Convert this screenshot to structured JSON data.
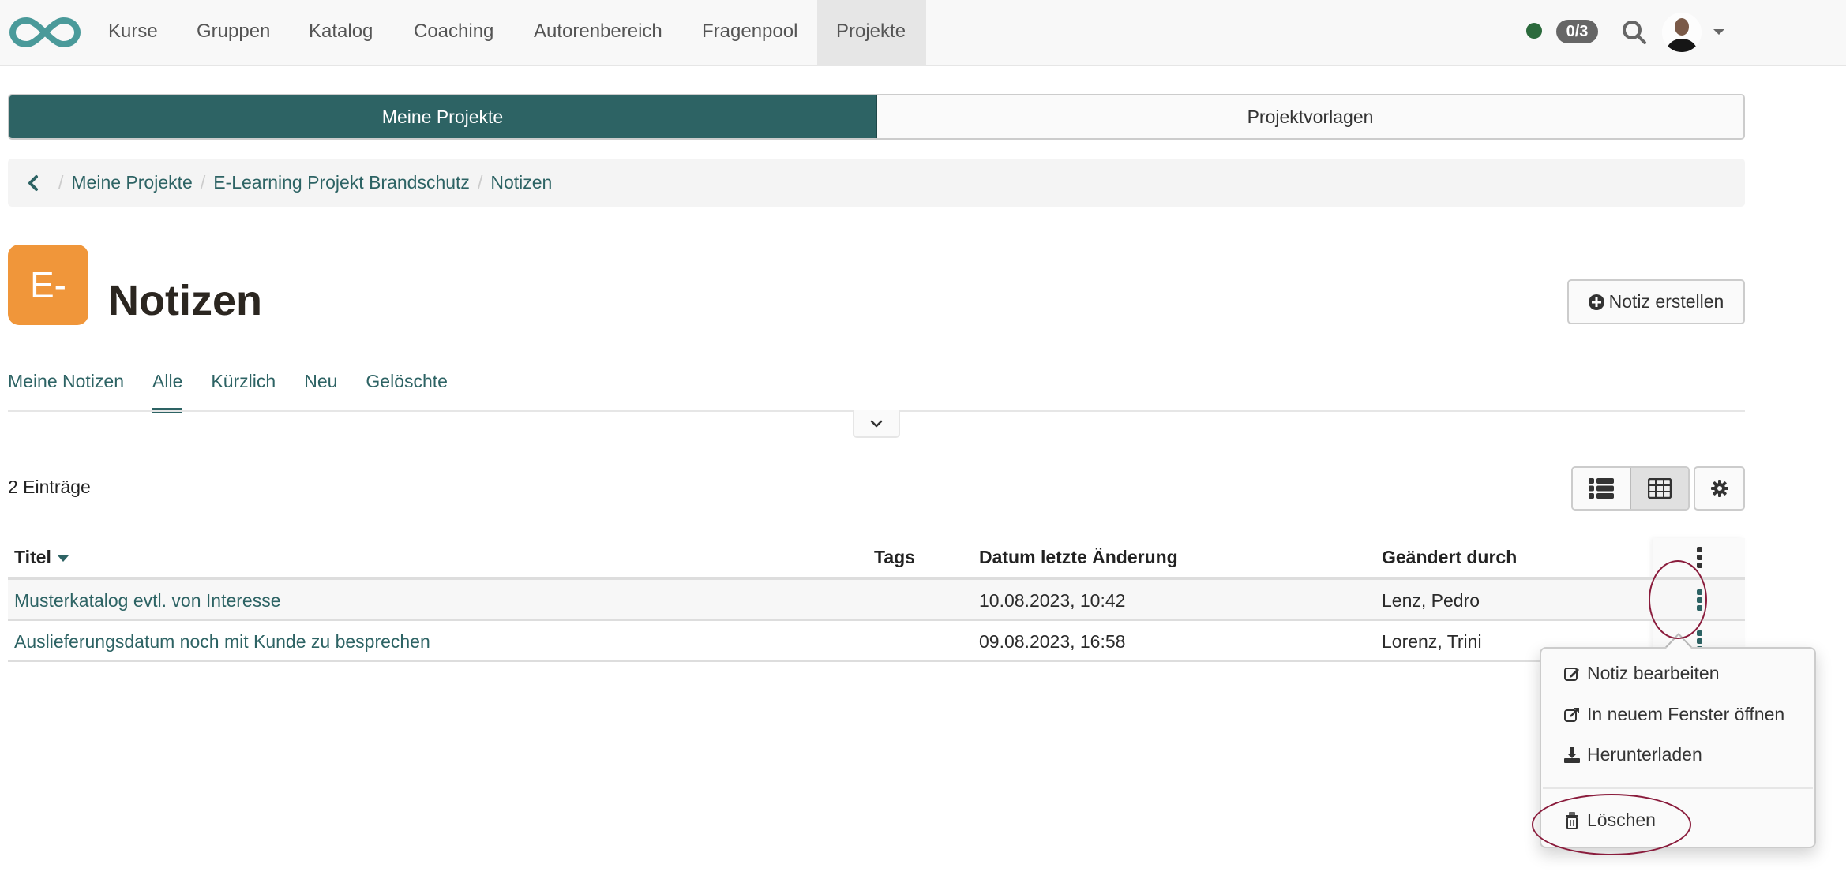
{
  "topbar": {
    "logo": "infinity-logo",
    "nav": [
      {
        "label": "Kurse",
        "active": false
      },
      {
        "label": "Gruppen",
        "active": false
      },
      {
        "label": "Katalog",
        "active": false
      },
      {
        "label": "Coaching",
        "active": false
      },
      {
        "label": "Autorenbereich",
        "active": false
      },
      {
        "label": "Fragenpool",
        "active": false
      },
      {
        "label": "Projekte",
        "active": true
      }
    ],
    "status_color": "#2b6a3c",
    "badge": "0/3",
    "icons": [
      "status-dot",
      "search-icon",
      "avatar",
      "caret-down-icon"
    ]
  },
  "segments": {
    "mine": "Meine Projekte",
    "templates": "Projektvorlagen",
    "active": "mine"
  },
  "breadcrumb": {
    "back_icon": "chevron-left-icon",
    "items": [
      "Meine Projekte",
      "E-Learning Projekt Brandschutz",
      "Notizen"
    ]
  },
  "header": {
    "tile_text": "E-",
    "tile_color": "#f0963a",
    "title": "Notizen",
    "create_button": "Notiz erstellen"
  },
  "tabs": [
    {
      "label": "Meine Notizen",
      "active": false
    },
    {
      "label": "Alle",
      "active": true
    },
    {
      "label": "Kürzlich",
      "active": false
    },
    {
      "label": "Neu",
      "active": false
    },
    {
      "label": "Gelöschte",
      "active": false
    }
  ],
  "toolbar": {
    "count": "2 Einträge",
    "view_modes": [
      "list-view",
      "table-view"
    ],
    "active_view": "table-view"
  },
  "table": {
    "columns": [
      "Titel",
      "Tags",
      "Datum letzte Änderung",
      "Geändert durch"
    ],
    "sort_column": "Titel",
    "rows": [
      {
        "title": "Musterkatalog evtl. von Interesse",
        "tags": "",
        "date": "10.08.2023, 10:42",
        "changed_by": "Lenz, Pedro"
      },
      {
        "title": "Auslieferungsdatum noch mit Kunde zu besprechen",
        "tags": "",
        "date": "09.08.2023, 16:58",
        "changed_by": "Lorenz, Trini"
      }
    ]
  },
  "context_menu": {
    "items": [
      {
        "label": "Notiz bearbeiten",
        "icon": "edit-icon"
      },
      {
        "label": "In neuem Fenster öffnen",
        "icon": "external-link-icon"
      },
      {
        "label": "Herunterladen",
        "icon": "download-icon"
      }
    ],
    "danger_item": {
      "label": "Löschen",
      "icon": "trash-icon"
    }
  },
  "colors": {
    "accent": "#2d6364",
    "highlight_ring": "#8a1c3c"
  }
}
